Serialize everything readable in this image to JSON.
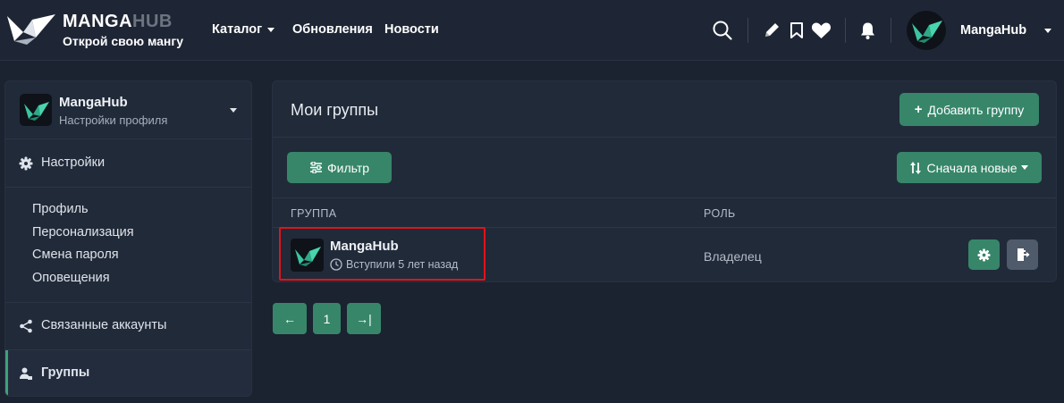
{
  "brand": {
    "name_main": "MANGA",
    "name_accent": "HUB",
    "tagline": "Открой свою мангу"
  },
  "nav": {
    "catalog": "Каталог",
    "updates": "Обновления",
    "news": "Новости"
  },
  "header_icons": [
    "search-icon",
    "pencil-icon",
    "bookmark-icon",
    "heart-icon",
    "bell-icon"
  ],
  "user": {
    "name": "MangaHub"
  },
  "sidebar": {
    "profile": {
      "name": "MangaHub",
      "subtitle": "Настройки профиля"
    },
    "settings_label": "Настройки",
    "settings_items": [
      "Профиль",
      "Персонализация",
      "Смена пароля",
      "Оповещения"
    ],
    "linked_accounts_label": "Связанные аккаунты",
    "groups_label": "Группы"
  },
  "main": {
    "title": "Мои группы",
    "add_group_label": "Добавить группу",
    "filter_label": "Фильтр",
    "sort_label": "Сначала новые",
    "columns": [
      "ГРУППА",
      "РОЛЬ"
    ],
    "groups": [
      {
        "name": "MangaHub",
        "joined": "Вступили 5 лет назад",
        "role": "Владелец"
      }
    ]
  },
  "pagination": {
    "prev": "←",
    "current": "1",
    "last": "→|"
  },
  "colors": {
    "accent": "#37866a",
    "background": "#1b2230",
    "panel": "#212a39",
    "highlight": "#e0141a"
  }
}
